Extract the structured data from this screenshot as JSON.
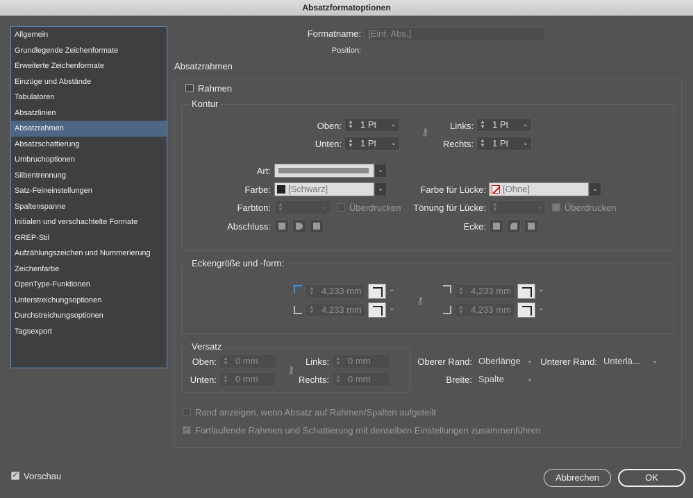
{
  "window": {
    "title": "Absatzformatoptionen"
  },
  "sidebar": {
    "items": [
      {
        "label": "Allgemein"
      },
      {
        "label": "Grundlegende Zeichenformate"
      },
      {
        "label": "Erweiterte Zeichenformate"
      },
      {
        "label": "Einzüge und Abstände"
      },
      {
        "label": "Tabulatoren"
      },
      {
        "label": "Absatzlinien"
      },
      {
        "label": "Absatzrahmen",
        "active": true
      },
      {
        "label": "Absatzschattierung"
      },
      {
        "label": "Umbruchoptionen"
      },
      {
        "label": "Silbentrennung"
      },
      {
        "label": "Satz-Feineinstellungen"
      },
      {
        "label": "Spaltenspanne"
      },
      {
        "label": "Initialen und verschachtelte Formate"
      },
      {
        "label": "GREP-Stil"
      },
      {
        "label": "Aufzählungszeichen und Nummerierung"
      },
      {
        "label": "Zeichenfarbe"
      },
      {
        "label": "OpenType-Funktionen"
      },
      {
        "label": "Unterstreichungsoptionen"
      },
      {
        "label": "Durchstreichungsoptionen"
      },
      {
        "label": "Tagsexport"
      }
    ]
  },
  "header": {
    "formatname_label": "Formatname:",
    "formatname_value": "[Einf. Abs.]",
    "position_label": "Position:",
    "section_title": "Absatzrahmen"
  },
  "rahmen": {
    "label": "Rahmen",
    "checked": false
  },
  "kontur": {
    "title": "Kontur",
    "oben_label": "Oben:",
    "oben_value": "1 Pt",
    "unten_label": "Unten:",
    "unten_value": "1 Pt",
    "links_label": "Links:",
    "links_value": "1 Pt",
    "rechts_label": "Rechts:",
    "rechts_value": "1 Pt",
    "art_label": "Art:",
    "farbe_label": "Farbe:",
    "farbe_value": "[Schwarz]",
    "farbe_luecke_label": "Farbe für Lücke:",
    "farbe_luecke_value": "[Ohne]",
    "farbton_label": "Farbton:",
    "ueberdrucken_label": "Überdrucken",
    "toenung_label": "Tönung für Lücke:",
    "ueberdrucken2_label": "Überdrucken",
    "abschluss_label": "Abschluss:",
    "ecke_label": "Ecke:"
  },
  "ecken": {
    "title": "Eckengröße und -form:",
    "tl_value": "4,233 mm",
    "bl_value": "4,233 mm",
    "tr_value": "4,233 mm",
    "br_value": "4,233 mm"
  },
  "versatz": {
    "title": "Versatz",
    "oben_label": "Oben:",
    "oben_value": "0 mm",
    "unten_label": "Unten:",
    "unten_value": "0 mm",
    "links_label": "Links:",
    "links_value": "0 mm",
    "rechts_label": "Rechts:",
    "rechts_value": "0 mm",
    "oberer_rand_label": "Oberer Rand:",
    "oberer_rand_value": "Oberlänge",
    "unterer_rand_label": "Unterer Rand:",
    "unterer_rand_value": "Unterlä...",
    "breite_label": "Breite:",
    "breite_value": "Spalte"
  },
  "options": {
    "rand_label": "Rand anzeigen, wenn Absatz auf Rahmen/Spalten aufgeteilt",
    "fortlaufend_label": "Fortlaufende Rahmen und Schattierung mit denselben Einstellungen zusammenführen"
  },
  "footer": {
    "vorschau_label": "Vorschau",
    "abbrechen_label": "Abbrechen",
    "ok_label": "OK"
  }
}
